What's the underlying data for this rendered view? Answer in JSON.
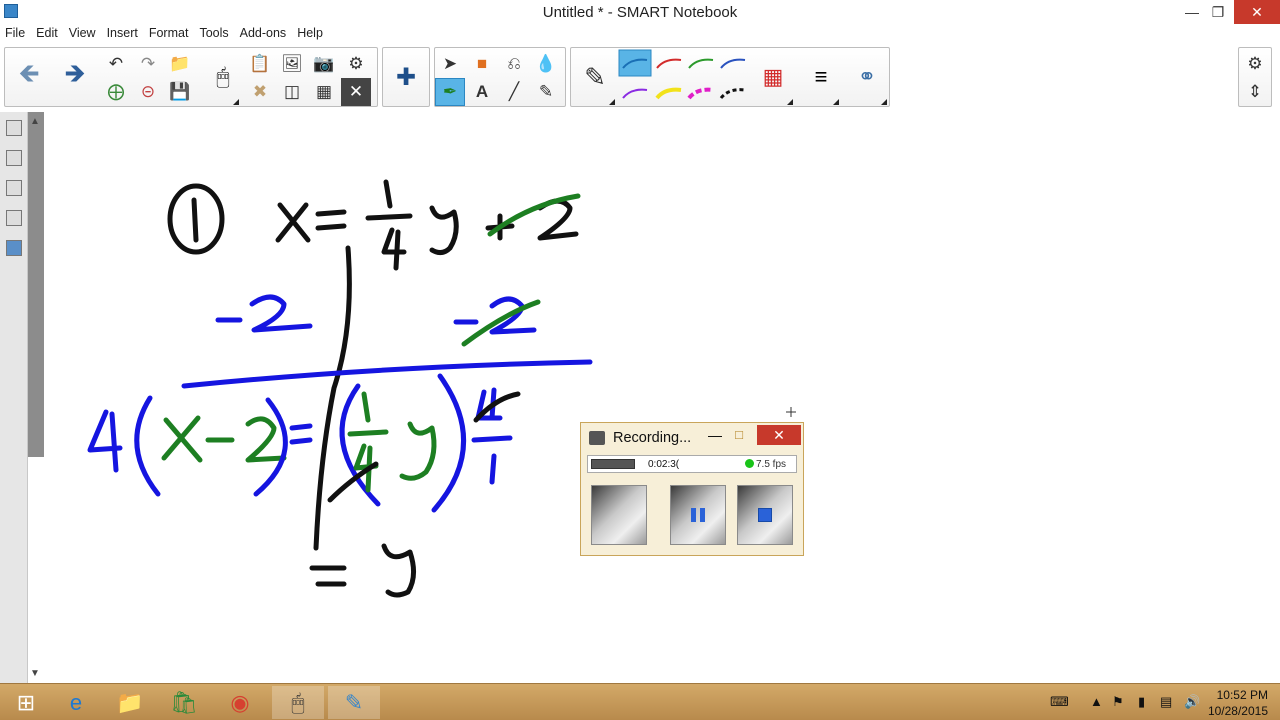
{
  "window": {
    "title": "Untitled * - SMART Notebook"
  },
  "menu": [
    "File",
    "Edit",
    "View",
    "Insert",
    "Format",
    "Tools",
    "Add-ons",
    "Help"
  ],
  "toolbar": {
    "nav": [
      "back-arrow-icon",
      "forward-arrow-icon"
    ],
    "selected_tools": [
      "pen-blue-line",
      "creative-pen"
    ],
    "pen_colors": [
      "#1a6fb5",
      "#d22b2b",
      "#2c9a2c",
      "#2a52be",
      "#8a2be2",
      "#f2e21a",
      "#e01ec8",
      "#111111"
    ]
  },
  "recording": {
    "title": "Recording...",
    "time": "0:02:3(",
    "fps": "7.5 fps",
    "indicator_color": "#19c419"
  },
  "taskbar": {
    "time": "10:52 PM",
    "date": "10/28/2015"
  }
}
